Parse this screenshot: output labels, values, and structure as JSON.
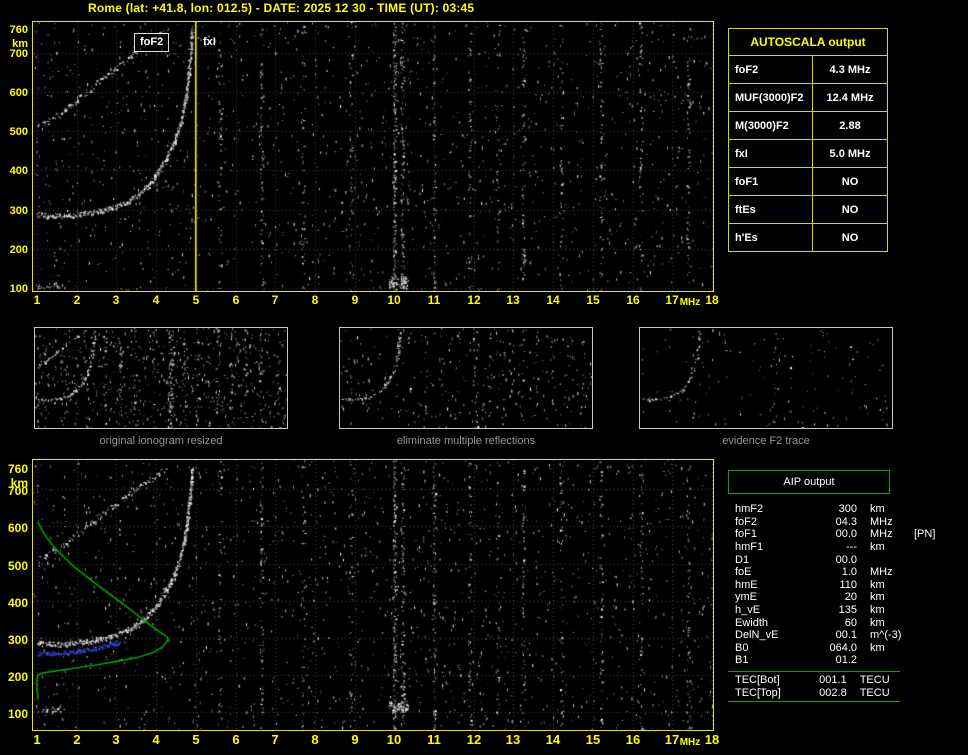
{
  "title": "Rome (lat: +41.8, lon: 012.5) - DATE: 2025 12 30 - TIME (UT): 03:45",
  "autoscala": {
    "header": "AUTOSCALA output",
    "rows": [
      {
        "label": "foF2",
        "value": "4.3 MHz",
        "color": "#ffffff"
      },
      {
        "label": "MUF(3000)F2",
        "value": "12.4 MHz",
        "color": "#ffffff"
      },
      {
        "label": "M(3000)F2",
        "value": "2.88",
        "color": "#ffffff"
      },
      {
        "label": "fxI",
        "value": "5.0 MHz",
        "color": "#ffff00"
      },
      {
        "label": "foF1",
        "value": "NO",
        "color": "#ff2a2a"
      },
      {
        "label": "ftEs",
        "value": "NO",
        "color": "#3c6bff"
      },
      {
        "label": "h'Es",
        "value": "NO",
        "color": "#ffffff"
      }
    ]
  },
  "thumbnails": [
    {
      "caption": "original ionogram resized"
    },
    {
      "caption": "eliminate multiple reflections"
    },
    {
      "caption": "evidence F2 trace"
    }
  ],
  "aip": {
    "header": "AIP output",
    "rows": [
      {
        "label": "hmF2",
        "value": "300",
        "unit": "km",
        "note": ""
      },
      {
        "label": "foF2",
        "value": "04.3",
        "unit": "MHz",
        "note": ""
      },
      {
        "label": "foF1",
        "value": "00.0",
        "unit": "MHz",
        "note": "[PN]"
      },
      {
        "label": "hmF1",
        "value": "---",
        "unit": "km",
        "note": ""
      },
      {
        "label": "D1",
        "value": "00.0",
        "unit": "",
        "note": ""
      },
      {
        "label": "foE",
        "value": "1.0",
        "unit": "MHz",
        "note": ""
      },
      {
        "label": "hmE",
        "value": "110",
        "unit": "km",
        "note": ""
      },
      {
        "label": "ymE",
        "value": "20",
        "unit": "km",
        "note": ""
      },
      {
        "label": "h_vE",
        "value": "135",
        "unit": "km",
        "note": ""
      },
      {
        "label": "Ewidth",
        "value": "60",
        "unit": "km",
        "note": ""
      },
      {
        "label": "DelN_vE",
        "value": "00.1",
        "unit": "m^(-3)",
        "note": ""
      },
      {
        "label": "B0",
        "value": "064.0",
        "unit": "km",
        "note": ""
      },
      {
        "label": "B1",
        "value": "01.2",
        "unit": "",
        "note": ""
      }
    ],
    "tec_rows": [
      {
        "label": "TEC[Bot]",
        "value": "001.1",
        "unit": "TECU"
      },
      {
        "label": "TEC[Top]",
        "value": "002.8",
        "unit": "TECU"
      }
    ]
  },
  "chart_data": {
    "type": "scatter",
    "title": "Rome vertical-incidence ionogram, 2025-12-30 03:45 UT",
    "xlabel": "MHz",
    "ylabel": "km",
    "xlim": [
      1,
      18
    ],
    "ylim": [
      100,
      760
    ],
    "x_ticks": [
      1,
      2,
      3,
      4,
      5,
      6,
      7,
      8,
      9,
      10,
      11,
      12,
      13,
      14,
      15,
      16,
      17,
      18
    ],
    "y_ticks": [
      760,
      700,
      600,
      500,
      400,
      300,
      200,
      100
    ],
    "grid": "dotted",
    "legend_position": "none",
    "markers": {
      "foF2_MHz": 4.3,
      "fxI_MHz": 5.0,
      "foF2_label": "foF2",
      "fxI_label": "fxI"
    },
    "series": [
      {
        "name": "F2 trace (1st order echo)",
        "color": "#ffffff",
        "points": [
          [
            1.0,
            287
          ],
          [
            1.4,
            284
          ],
          [
            1.8,
            285
          ],
          [
            2.2,
            290
          ],
          [
            2.6,
            297
          ],
          [
            3.0,
            308
          ],
          [
            3.3,
            322
          ],
          [
            3.6,
            342
          ],
          [
            3.85,
            368
          ],
          [
            4.05,
            396
          ],
          [
            4.25,
            430
          ],
          [
            4.45,
            472
          ],
          [
            4.6,
            516
          ],
          [
            4.7,
            562
          ],
          [
            4.78,
            616
          ],
          [
            4.84,
            672
          ],
          [
            4.88,
            722
          ],
          [
            4.9,
            758
          ]
        ]
      },
      {
        "name": "F2 trace (2nd order echo)",
        "color": "#ffffff",
        "points": [
          [
            1.0,
            508
          ],
          [
            1.5,
            540
          ],
          [
            2.0,
            578
          ],
          [
            2.5,
            622
          ],
          [
            3.0,
            662
          ],
          [
            3.5,
            702
          ],
          [
            4.0,
            738
          ],
          [
            4.25,
            757
          ]
        ]
      },
      {
        "name": "Autoscala restored trace",
        "color": "#3c3cff",
        "points": [
          [
            1.0,
            258
          ],
          [
            1.4,
            259
          ],
          [
            1.8,
            262
          ],
          [
            2.2,
            267
          ],
          [
            2.6,
            275
          ],
          [
            2.9,
            284
          ],
          [
            3.1,
            292
          ]
        ]
      },
      {
        "name": "Electron density profile",
        "color": "#00b400",
        "points": [
          [
            1.02,
            612
          ],
          [
            1.15,
            585
          ],
          [
            1.35,
            555
          ],
          [
            1.6,
            525
          ],
          [
            1.95,
            490
          ],
          [
            2.4,
            452
          ],
          [
            2.9,
            412
          ],
          [
            3.4,
            372
          ],
          [
            3.8,
            338
          ],
          [
            4.1,
            315
          ],
          [
            4.28,
            302
          ],
          [
            4.3,
            300
          ],
          [
            4.28,
            290
          ],
          [
            4.15,
            274
          ],
          [
            3.9,
            259
          ],
          [
            3.5,
            246
          ],
          [
            3.0,
            236
          ],
          [
            2.5,
            227
          ],
          [
            2.0,
            219
          ],
          [
            1.5,
            211
          ],
          [
            1.15,
            205
          ],
          [
            1.02,
            200
          ],
          [
            1.0,
            188
          ],
          [
            1.0,
            160
          ],
          [
            1.03,
            134
          ]
        ]
      }
    ],
    "noise_stripes": [
      [
        5.6,
        0.5
      ],
      [
        6.65,
        0.8
      ],
      [
        7.7,
        0.5
      ],
      [
        8.9,
        0.4
      ],
      [
        10.0,
        1.7
      ],
      [
        10.2,
        1.1
      ],
      [
        11.0,
        0.7
      ],
      [
        11.9,
        0.6
      ],
      [
        12.6,
        0.4
      ],
      [
        13.25,
        0.6
      ],
      [
        14.2,
        0.5
      ],
      [
        15.2,
        0.6
      ],
      [
        16.2,
        0.5
      ],
      [
        17.4,
        0.6
      ]
    ]
  }
}
